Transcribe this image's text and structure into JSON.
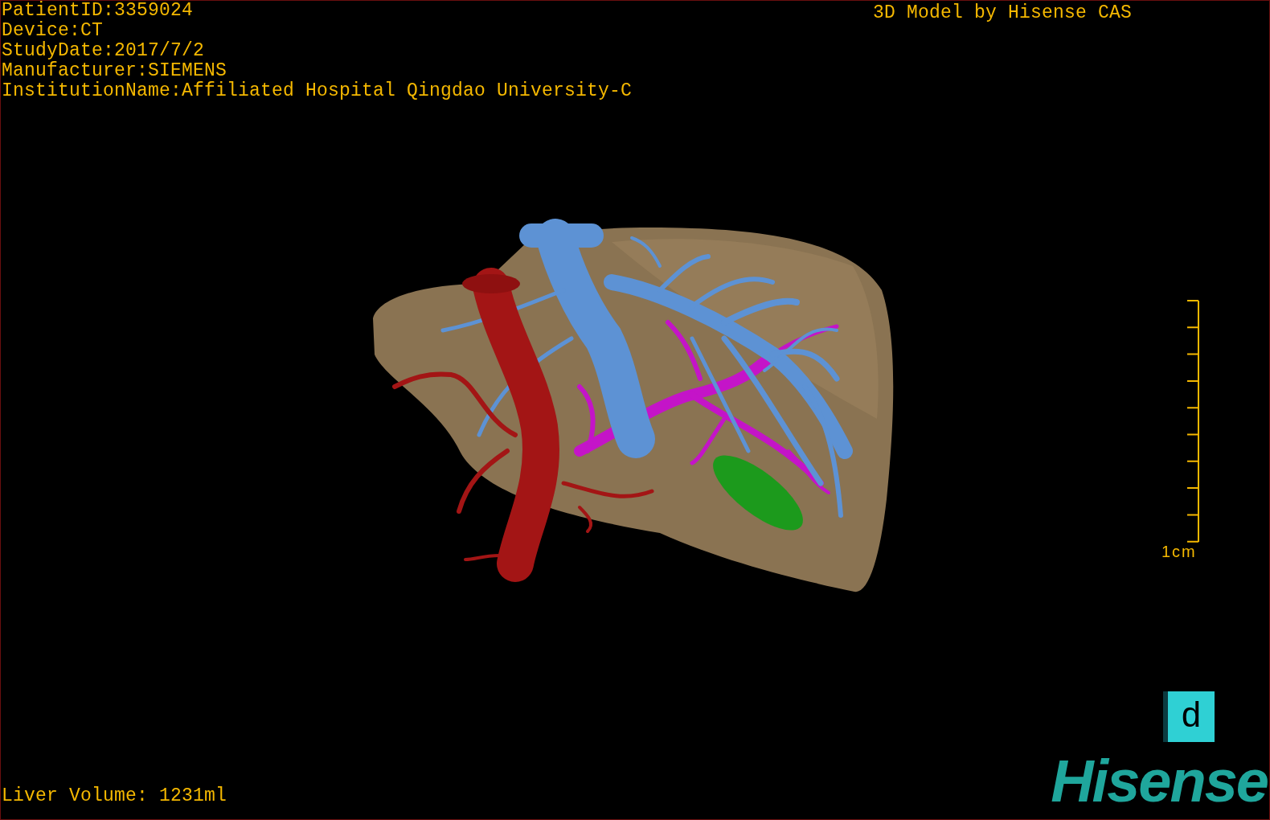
{
  "patient_info": [
    "PatientID:3359024",
    "Device:CT",
    "StudyDate:2017/7/2",
    "Manufacturer:SIEMENS",
    "InstitutionName:Affiliated Hospital Qingdao University-C"
  ],
  "model_caption": "3D Model by Hisense CAS",
  "scale_bar": {
    "label": "1cm"
  },
  "view_button": {
    "label": "d"
  },
  "logo": {
    "text": "Hisense"
  },
  "liver_volume": "Liver Volume: 1231ml"
}
